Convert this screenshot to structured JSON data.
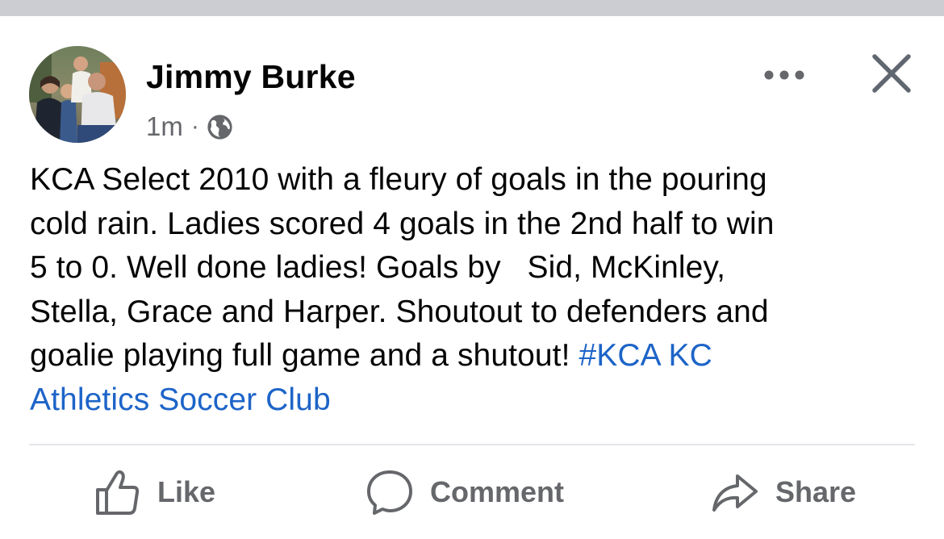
{
  "post": {
    "author": "Jimmy Burke",
    "timestamp": "1m",
    "separator": "·",
    "audience_icon": "globe-icon",
    "text_lines": [
      "KCA Select 2010 with a fleury of goals in the pouring",
      "cold rain. Ladies scored 4 goals in the 2nd half to win",
      "5 to 0. Well done ladies! Goals by   Sid, McKinley,",
      "Stella, Grace and Harper. Shoutout to defenders and",
      "goalie playing full game and a shutout! "
    ],
    "hashtag": "#KCA",
    "tagged_page_part1": "KC",
    "tagged_page_part2": "Athletics Soccer Club"
  },
  "header_icons": {
    "more": "more-options-icon",
    "close": "close-icon"
  },
  "actions": {
    "like": {
      "label": "Like",
      "icon": "thumbs-up-icon"
    },
    "comment": {
      "label": "Comment",
      "icon": "comment-bubble-icon"
    },
    "share": {
      "label": "Share",
      "icon": "share-arrow-icon"
    }
  },
  "colors": {
    "link": "#1d64c8",
    "secondary_text": "#65676b",
    "top_strip": "#cbcdd2",
    "divider": "#e4e6eb"
  }
}
